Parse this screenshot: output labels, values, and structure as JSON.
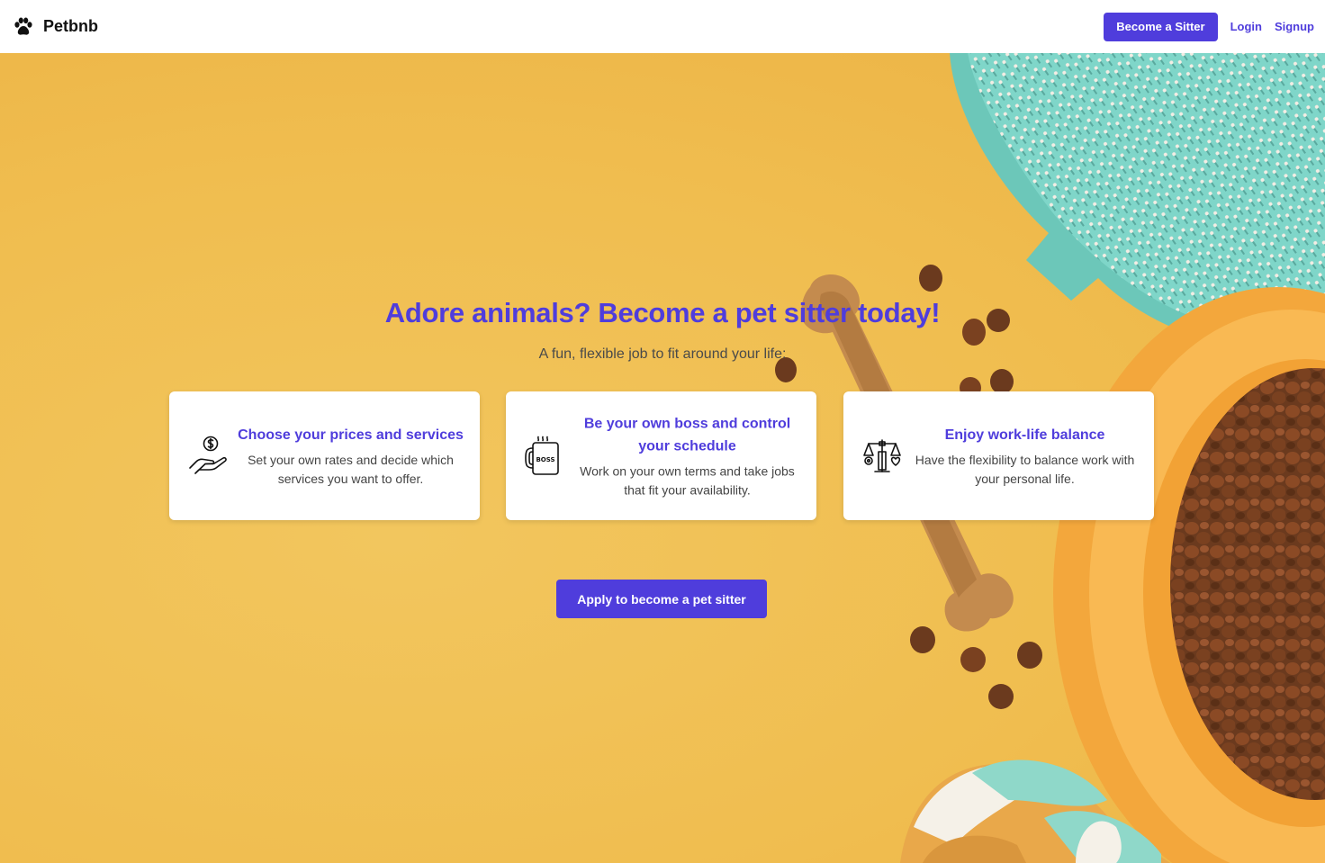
{
  "header": {
    "brand": "Petbnb",
    "become_sitter": "Become a Sitter",
    "login": "Login",
    "signup": "Signup"
  },
  "hero": {
    "title": "Adore animals? Become a pet sitter today!",
    "subtitle": "A fun, flexible job to fit around your life:",
    "cards": [
      {
        "title": "Choose your prices and services",
        "text": "Set your own rates and decide which services you want to offer.",
        "icon": "hand-dollar-icon"
      },
      {
        "title": "Be your own boss and control your schedule",
        "text": "Work on your own terms and take jobs that fit your availability.",
        "icon": "boss-mug-icon",
        "icon_text": "BOSS"
      },
      {
        "title": "Enjoy work-life balance",
        "text": "Have the flexibility to balance work with your personal life.",
        "icon": "balance-scale-icon"
      }
    ],
    "apply_button": "Apply to become a pet sitter"
  },
  "colors": {
    "accent": "#4f3ddc",
    "background": "#f0bd52"
  }
}
